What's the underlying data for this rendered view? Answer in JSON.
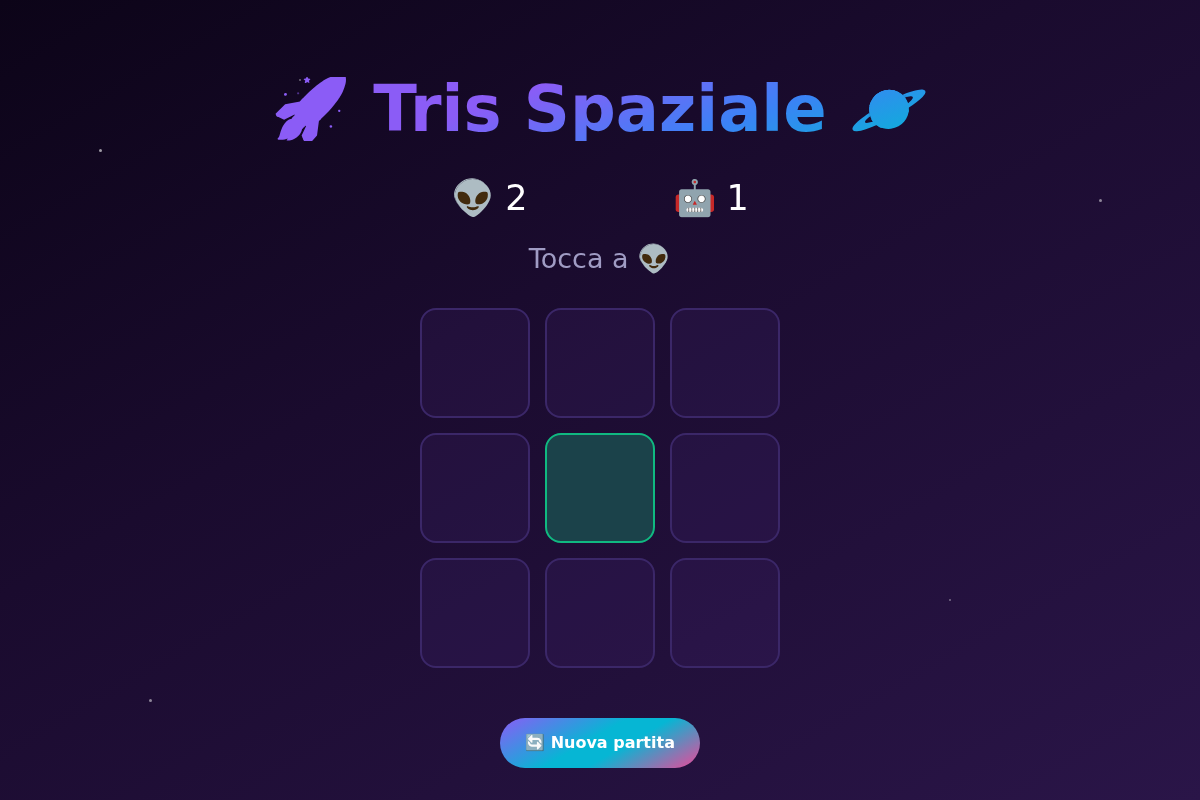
{
  "title": "🚀 Tris Spaziale 🪐",
  "scores": [
    {
      "player": "👽",
      "score": "2"
    },
    {
      "player": "🤖",
      "score": "1"
    }
  ],
  "turn": "Tocca a 👽",
  "board": {
    "cells": [
      {
        "selected": false
      },
      {
        "selected": false
      },
      {
        "selected": false
      },
      {
        "selected": false
      },
      {
        "selected": true
      },
      {
        "selected": false
      },
      {
        "selected": false
      },
      {
        "selected": false
      },
      {
        "selected": false
      }
    ]
  },
  "new_game_button": "🔄 Nuova partita"
}
